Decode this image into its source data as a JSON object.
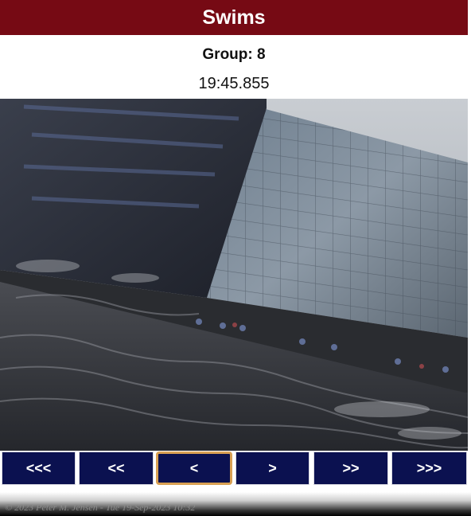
{
  "header": {
    "title": "Swims"
  },
  "info": {
    "group": "Group: 8",
    "time": "19:45.855"
  },
  "photo": {
    "icon": "camera-photo"
  },
  "nav": {
    "buttons": [
      {
        "label": "<<<"
      },
      {
        "label": "<<"
      },
      {
        "label": "<"
      },
      {
        "label": ">"
      },
      {
        "label": ">>"
      },
      {
        "label": ">>>"
      }
    ],
    "active_index": 2
  },
  "footer": {
    "text": "© 2023 Peter M. Jensen - Tue 19-Sep-2023 10:32"
  },
  "colors": {
    "header_bg": "#760a14",
    "button_bg": "#0b1150",
    "active_border": "#d9a053"
  }
}
